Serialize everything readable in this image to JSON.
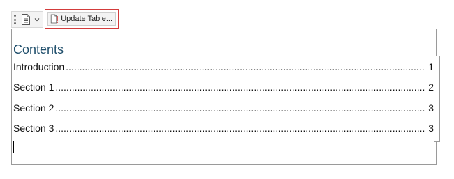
{
  "toolbar": {
    "update_label": "Update Table..."
  },
  "toc": {
    "title": "Contents",
    "entries": [
      {
        "label": "Introduction",
        "page": "1"
      },
      {
        "label": "Section 1",
        "page": "2"
      },
      {
        "label": "Section 2",
        "page": "3"
      },
      {
        "label": "Section 3",
        "page": "3"
      }
    ]
  },
  "colors": {
    "title": "#1f4e6b",
    "highlight_border": "#d33b3b"
  },
  "icons": [
    "grip-icon",
    "document-icon",
    "chevron-down-icon",
    "update-table-icon"
  ]
}
